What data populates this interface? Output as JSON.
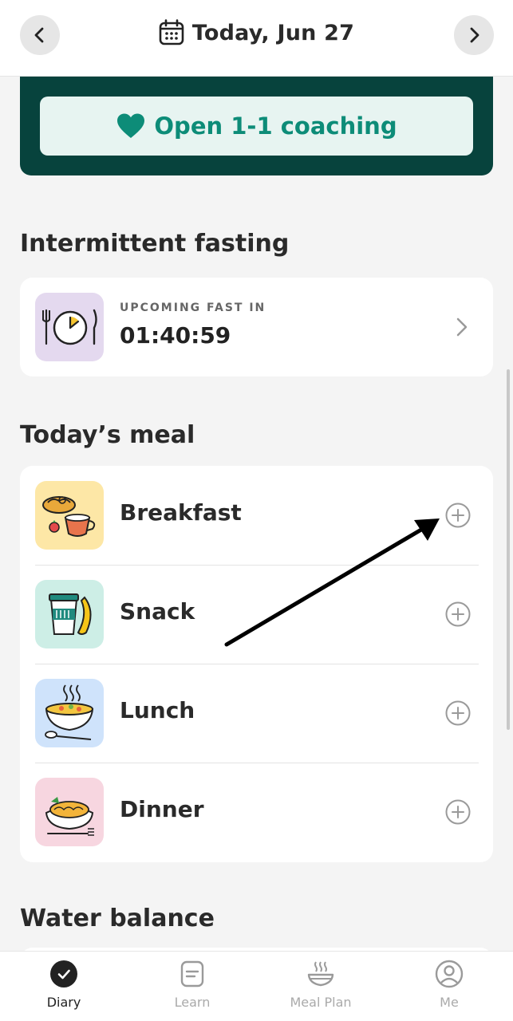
{
  "header": {
    "title": "Today, Jun 27"
  },
  "coaching": {
    "button_label": "Open 1-1 coaching"
  },
  "fasting": {
    "section_title": "Intermittent fasting",
    "label": "UPCOMING FAST IN",
    "countdown": "01:40:59"
  },
  "meals": {
    "section_title": "Today’s meal",
    "items": [
      {
        "label": "Breakfast",
        "thumb_color": "#fde7a6"
      },
      {
        "label": "Snack",
        "thumb_color": "#cdeee6"
      },
      {
        "label": "Lunch",
        "thumb_color": "#cfe3fb"
      },
      {
        "label": "Dinner",
        "thumb_color": "#f7d6e0"
      }
    ]
  },
  "water": {
    "section_title": "Water balance"
  },
  "bottom_nav": {
    "items": [
      {
        "label": "Diary",
        "icon": "check-circle-icon",
        "active": true
      },
      {
        "label": "Learn",
        "icon": "document-icon",
        "active": false
      },
      {
        "label": "Meal Plan",
        "icon": "bowl-icon",
        "active": false
      },
      {
        "label": "Me",
        "icon": "person-circle-icon",
        "active": false
      }
    ]
  },
  "colors": {
    "brand_dark": "#07433d",
    "brand_teal": "#0d8c78",
    "coaching_bg": "#e7f4f1"
  }
}
